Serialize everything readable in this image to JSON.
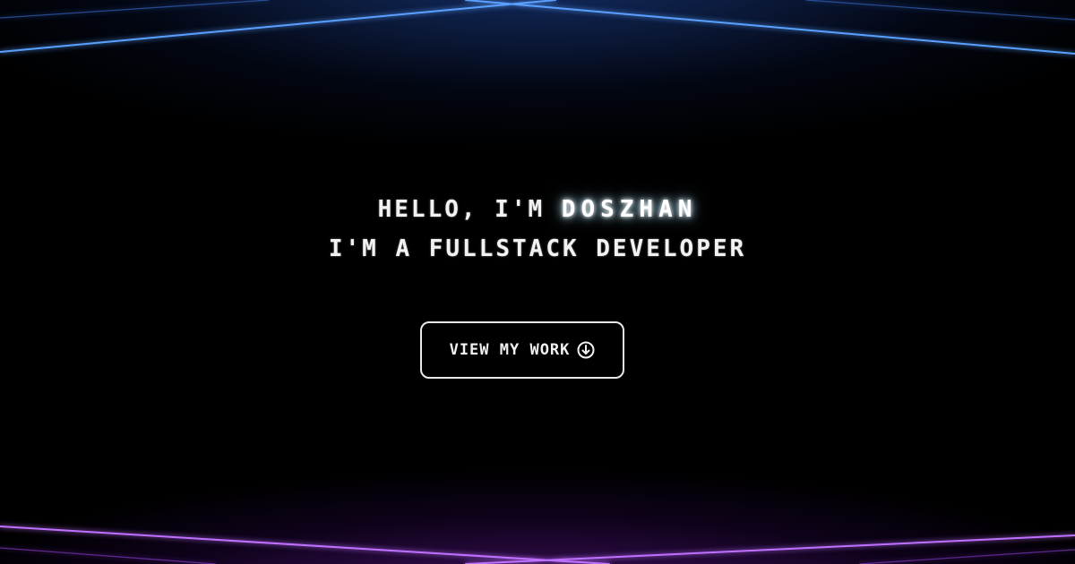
{
  "hero": {
    "greeting_prefix": "Hello, i'm ",
    "name": "doszhan",
    "subtitle": "i'm a fullstack developer"
  },
  "cta": {
    "label": "View my work",
    "icon": "arrow-down-circle-icon"
  },
  "colors": {
    "background": "#000000",
    "top_beam": "#4a8dff",
    "bottom_beam": "#b45bff",
    "text": "#f2f2f2"
  }
}
